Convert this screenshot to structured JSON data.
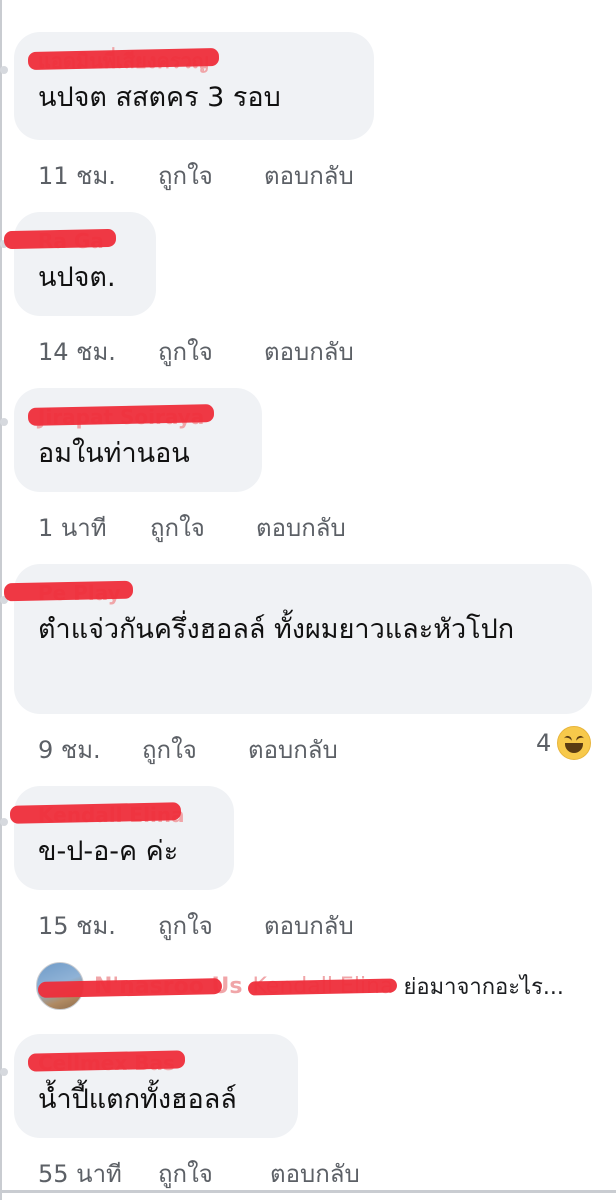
{
  "comments": [
    {
      "name": "แอดมินพี่เสียงครวญ",
      "text": "นปจต สสตคร 3 รอบ",
      "time": "11 ชม.",
      "like": "ถูกใจ",
      "reply": "ตอบกลับ"
    },
    {
      "name": "Ra Ga",
      "text": "นปจต.",
      "time": "14 ชม.",
      "like": "ถูกใจ",
      "reply": "ตอบกลับ"
    },
    {
      "name": "Jirapat Soiraya",
      "text": "อมในท่านอน",
      "time": "1 นาที",
      "like": "ถูกใจ",
      "reply": "ตอบกลับ"
    },
    {
      "name": "Pe Play",
      "text": "ตำแจ่วกันครึ่งฮอลล์ ทั้งผมยาวและหัวโปก",
      "time": "9 ชม.",
      "like": "ถูกใจ",
      "reply": "ตอบกลับ",
      "reaction_count": "4",
      "reaction_icon": "haha-emoji-icon"
    },
    {
      "name": "Kendall Elina",
      "text": "ข-ป-อ-ค ค่ะ",
      "time": "15 ชม.",
      "like": "ถูกใจ",
      "reply": "ตอบกลับ"
    },
    {
      "name": "Cellmex Bas",
      "text": "น้ำปี้แตกทั้งฮอลล์",
      "time": "55 นาที",
      "like": "ถูกใจ",
      "reply": "ตอบกลับ"
    }
  ],
  "reply_preview": {
    "author": "N'nasroo Us",
    "mention": "Kendall Elina",
    "text": "ย่อมาจากอะไร..."
  },
  "colors": {
    "bubble": "#f0f2f5",
    "redaction": "#ee2d3a",
    "meta": "#5c6066"
  }
}
